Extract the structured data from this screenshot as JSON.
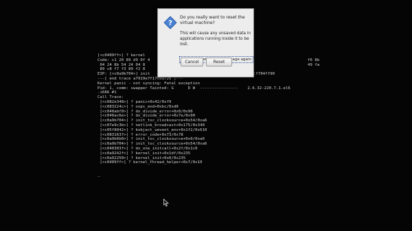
{
  "console": {
    "lines": [
      "[<c0409ff>] ? kernel",
      "Code: c1 20 89 d9 0f 4",
      " 04 24 8b 54 24 04 8",
      " 89 c8 f7 f3 89 f2 8",
      "EIP: [<c0a9b704>] init",
      "---[ end trace a7919e7f17c0a726 ]---",
      "Kernel panic - not syncing: Fatal exception",
      "Pid: 1, comm: swapper Tainted: G      D W  ----------------    2.6.32-220.7.1.el6",
      ".i686 #1",
      "Call Trace:",
      " [<c082e348>] ? panic+0x42/0xf9",
      " [<c083224c>] ? oops_end+0xbc/0xd0",
      " [<c040abf0>] ? do_divide_error+0x0/0x90",
      " [<c040ac6e>] ? do_divide_error+0x7e/0x90",
      " [<c0a9b704>] ? init_tsc_clocksource+0x54/0xa6",
      " [<c07e9c3b>] ? netlink_broadcast+0x175/0x340",
      " [<c05f8042>] ? kobject_uevent_env+0x1f2/0x610",
      " [<c0831637>] ? error_code+0x73/0x78",
      " [<c0a9b6b0>] ? init_tsc_clocksource+0x0/0xa6",
      " [<c0a9b704>] ? init_tsc_clocksource+0x54/0xa6",
      " [<c040303f>] ? do_one_initcall+0x2f/0x1c0",
      " [<c0a9242f>] ? kernel_init+0x1df/0x235",
      " [<c0a92250>] ? kernel_init+0x0/0x235",
      " [<c0409ff>] ? kernel_thread_helper+0x7/0x10"
    ],
    "right_fragments": {
      "code1": "f6 8b",
      "code2": "49 fa",
      "eip_suffix": "69:f704ff90"
    },
    "cursor": "_"
  },
  "dialog": {
    "title": "Do you really want to reset the virtual machine?",
    "body": "This will cause any unsaved data in applications running inside it to be lost.",
    "checkbox_label": "Do not show this message again",
    "checkbox_checked": false,
    "cancel_label": "Cancel",
    "reset_label": "Reset"
  },
  "colors": {
    "background": "#050505",
    "console_text": "#d9d9d9",
    "dialog_bg": "#ededed",
    "icon_blue": "#3b73c7"
  }
}
